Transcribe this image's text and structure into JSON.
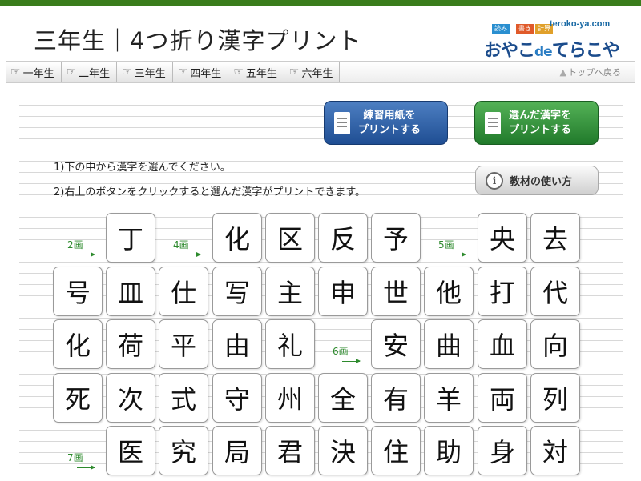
{
  "header": {
    "title": "三年生｜4つ折り漢字プリント",
    "logo": {
      "domain": "teroko-ya.com",
      "badges": [
        "読み",
        "書き",
        "計算"
      ],
      "main_a": "おやこ",
      "main_de": "de",
      "main_b": "てらこや",
      "badge_colors": [
        "#2a8fd0",
        "#e05a2a",
        "#e0a02a"
      ]
    }
  },
  "nav": {
    "tabs": [
      "一年生",
      "二年生",
      "三年生",
      "四年生",
      "五年生",
      "六年生"
    ],
    "back_to_top": "トップへ戻る"
  },
  "buttons": {
    "print_paper": [
      "練習用紙を",
      "プリントする"
    ],
    "print_selected": [
      "選んだ漢字を",
      "プリントする"
    ],
    "howto": "教材の使い方"
  },
  "instructions": [
    "1)下の中から漢字を選んでください。",
    "2)右上のボタンをクリックすると選んだ漢字がプリントできます。"
  ],
  "colors": {
    "accent_green": "#3a7d1c",
    "blue_button": "#1f4e93",
    "green_button": "#217a2b",
    "stroke_label": "#2d8a2d"
  },
  "kanji_rows": [
    [
      {
        "m": "2画"
      },
      "丁",
      {
        "m": "4画"
      },
      "化",
      "区",
      "反",
      "予",
      {
        "m": "5画"
      },
      "央",
      "去"
    ],
    [
      "号",
      "皿",
      "仕",
      "写",
      "主",
      "申",
      "世",
      "他",
      "打",
      "代"
    ],
    [
      "化",
      "荷",
      "平",
      "由",
      "礼",
      {
        "m": "6画"
      },
      "安",
      "曲",
      "血",
      "向"
    ],
    [
      "死",
      "次",
      "式",
      "守",
      "州",
      "全",
      "有",
      "羊",
      "両",
      "列"
    ],
    [
      {
        "m": "7画"
      },
      "医",
      "究",
      "局",
      "君",
      "決",
      "住",
      "助",
      "身",
      "対"
    ]
  ]
}
